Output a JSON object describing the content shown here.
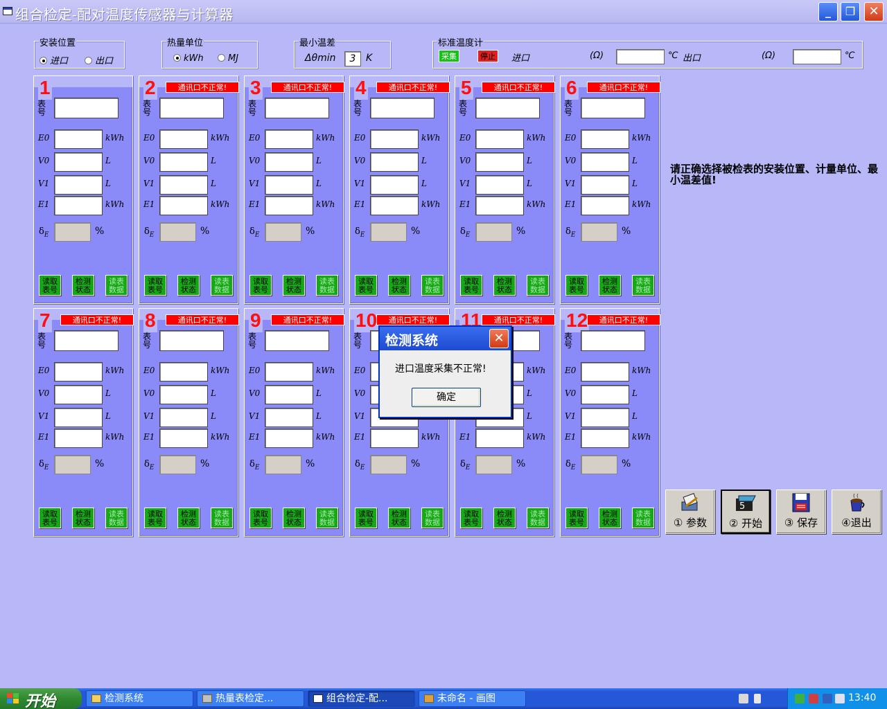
{
  "window": {
    "title": "组合检定-配对温度传感器与计算器",
    "min": "_",
    "max": "❐",
    "close": "✕"
  },
  "install": {
    "title": "安装位置",
    "options": [
      "进口",
      "出口"
    ],
    "selected": "进口"
  },
  "unit": {
    "title": "热量单位",
    "options": [
      "kWh",
      "MJ"
    ],
    "selected": "kWh"
  },
  "mindiff": {
    "title": "最小温差",
    "label": "Δθmin",
    "value": "3",
    "unit": "K"
  },
  "stdthermo": {
    "title": "标准温度计",
    "collect": "采集",
    "stop": "停止",
    "inlet": "进口",
    "ohm1": "(Ω)",
    "degc1": "℃",
    "outlet": "出口",
    "ohm2": "(Ω)",
    "degc2": "℃"
  },
  "panel_labels": {
    "meter_no": "表号",
    "e0": "E0",
    "e0_unit": "kWh",
    "v0": "V0",
    "v0_unit": "L",
    "v1": "V1",
    "v1_unit": "L",
    "e1": "E1",
    "e1_unit": "kWh",
    "delta": "δ",
    "delta_sub": "E",
    "pct": "%",
    "btn_read_no": "读取表号",
    "btn_check": "检测状态",
    "btn_read_data": "读表数据"
  },
  "panels": [
    {
      "num": "1",
      "warn": ""
    },
    {
      "num": "2",
      "warn": "通讯口不正常!"
    },
    {
      "num": "3",
      "warn": "通讯口不正常!"
    },
    {
      "num": "4",
      "warn": "通讯口不正常!"
    },
    {
      "num": "5",
      "warn": "通讯口不正常!"
    },
    {
      "num": "6",
      "warn": "通讯口不正常!"
    },
    {
      "num": "7",
      "warn": "通讯口不正常!"
    },
    {
      "num": "8",
      "warn": "通讯口不正常!"
    },
    {
      "num": "9",
      "warn": "通讯口不正常!"
    },
    {
      "num": "10",
      "warn": "通讯口不正常!"
    },
    {
      "num": "11",
      "warn": "通讯口不正常!"
    },
    {
      "num": "12",
      "warn": "通讯口不正常!"
    }
  ],
  "instruction": "请正确选择被检表的安装位置、计量单位、最小温差值!",
  "toolbar": {
    "params": "① 参数",
    "start": "② 开始",
    "save": "③ 保存",
    "exit": "④退出",
    "start_icon_digit": "5"
  },
  "dialog": {
    "title": "检测系统",
    "message": "进口温度采集不正常!",
    "ok": "确定",
    "close": "✕"
  },
  "taskbar": {
    "start": "开始",
    "tasks": [
      "检测系统",
      "热量表检定...",
      "组合检定-配...",
      "未命名 - 画图"
    ],
    "clock": "13:40"
  },
  "colors": {
    "background": "#b8b8f8",
    "panel": "#8a8af8",
    "warning": "#ff0000",
    "panel_number": "#ff1010",
    "button_green": "#17a817"
  }
}
